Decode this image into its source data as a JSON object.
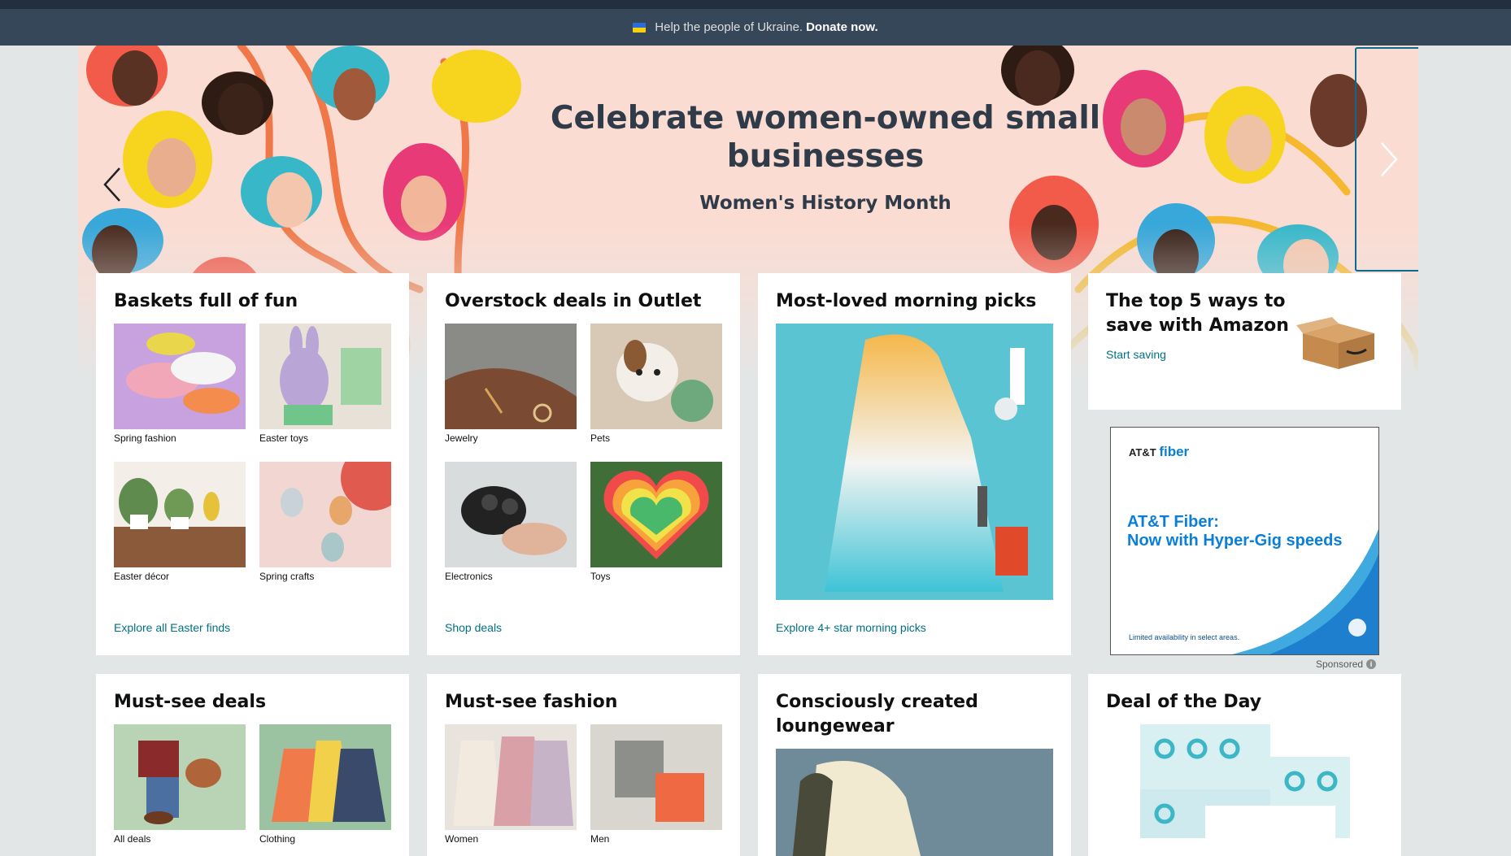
{
  "banner": {
    "message": "Help the people of Ukraine.",
    "donate_label": "Donate now."
  },
  "hero": {
    "title": "Celebrate women-owned small businesses",
    "subtitle": "Women's History Month"
  },
  "cards": {
    "baskets": {
      "title": "Baskets full of fun",
      "link": "Explore all Easter finds",
      "tiles": [
        "Spring fashion",
        "Easter toys",
        "Easter décor",
        "Spring crafts"
      ]
    },
    "outlet": {
      "title": "Overstock deals in Outlet",
      "link": "Shop deals",
      "tiles": [
        "Jewelry",
        "Pets",
        "Electronics",
        "Toys"
      ]
    },
    "morning": {
      "title": "Most-loved morning picks",
      "link": "Explore 4+ star morning picks"
    },
    "save": {
      "title": "The top 5 ways to save with Amazon",
      "link": "Start saving"
    },
    "ad": {
      "brand_small": "AT&T",
      "brand_fiber": "fiber",
      "headline_1": "AT&T Fiber:",
      "headline_2": "Now with Hyper-Gig speeds",
      "disclaimer": "Limited availability in select areas.",
      "sponsored": "Sponsored"
    },
    "mustsee_deals": {
      "title": "Must-see deals",
      "tiles": [
        "All deals",
        "Clothing"
      ]
    },
    "mustsee_fashion": {
      "title": "Must-see fashion",
      "tiles": [
        "Women",
        "Men"
      ]
    },
    "loungewear": {
      "title": "Consciously created loungewear"
    },
    "deal_day": {
      "title": "Deal of the Day"
    }
  },
  "colors": {
    "link": "#007185",
    "nav_dark": "#232f3e",
    "banner": "#37475a",
    "page_bg": "#e3e6e6"
  }
}
